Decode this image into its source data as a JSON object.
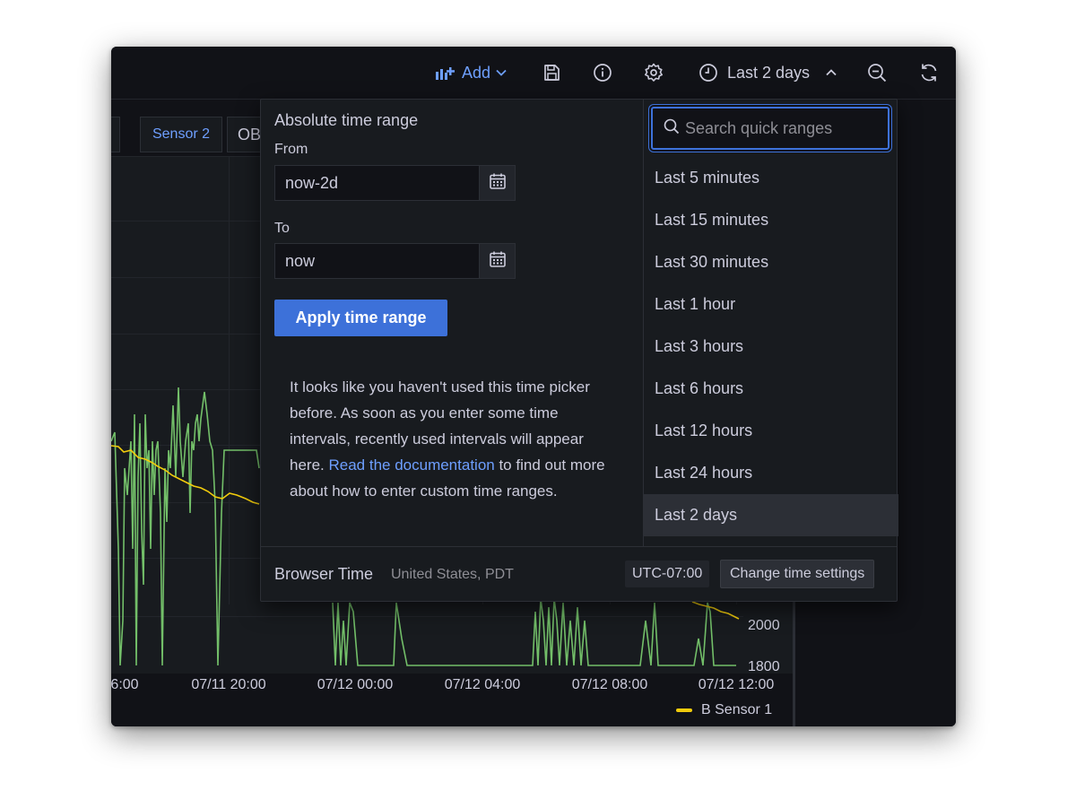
{
  "toolbar": {
    "add_label": "Add",
    "time_label": "Last 2 days",
    "icons": [
      "add-panel-icon",
      "chevron-down-icon",
      "save-icon",
      "info-icon",
      "gear-icon",
      "clock-icon",
      "chevron-up-icon",
      "zoom-out-icon",
      "refresh-icon"
    ]
  },
  "variables": {
    "sensor_chip": "Sensor 2",
    "partial_chip": "OB"
  },
  "chart": {
    "y_ticks": [
      "2000",
      "1800"
    ],
    "x_ticks": [
      "6:00",
      "07/11 20:00",
      "07/12 00:00",
      "07/12 04:00",
      "07/12 08:00",
      "07/12 12:00"
    ],
    "legend": "B Sensor 1",
    "colors": {
      "series_green": "#73bf69",
      "series_yellow": "#f2cc0c"
    }
  },
  "picker": {
    "title": "Absolute time range",
    "from_label": "From",
    "from_value": "now-2d",
    "to_label": "To",
    "to_value": "now",
    "apply_label": "Apply time range",
    "helper_text_1": "It looks like you haven't used this time picker before. As soon as you enter some time intervals, recently used intervals will appear here.",
    "helper_link": "Read the documentation",
    "helper_text_2": " to find out more about how to enter custom time ranges.",
    "search_placeholder": "Search quick ranges",
    "ranges": [
      "Last 5 minutes",
      "Last 15 minutes",
      "Last 30 minutes",
      "Last 1 hour",
      "Last 3 hours",
      "Last 6 hours",
      "Last 12 hours",
      "Last 24 hours",
      "Last 2 days"
    ],
    "selected_range": "Last 2 days",
    "footer": {
      "browser_time": "Browser Time",
      "location": "United States, PDT",
      "utc": "UTC-07:00",
      "change_label": "Change time settings"
    },
    "accent": "#3d71d9"
  }
}
